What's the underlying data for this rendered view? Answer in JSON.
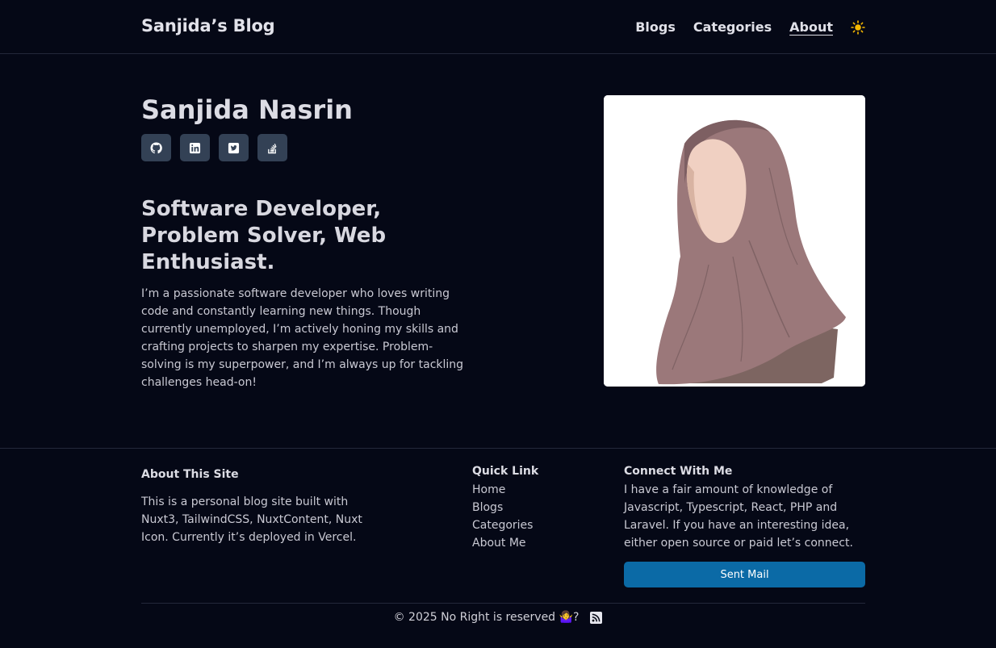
{
  "header": {
    "logo": "Sanjida’s Blog",
    "nav": [
      {
        "label": "Blogs"
      },
      {
        "label": "Categories"
      },
      {
        "label": "About"
      }
    ],
    "theme_icon": "sun-icon"
  },
  "hero": {
    "name": "Sanjida Nasrin",
    "socials": [
      {
        "icon": "github-icon"
      },
      {
        "icon": "linkedin-icon"
      },
      {
        "icon": "twitter-icon"
      },
      {
        "icon": "stackoverflow-icon"
      }
    ],
    "tagline": "Software Developer, Problem Solver, Web Enthusiast.",
    "bio": "I’m a passionate software developer who loves writing code and constantly learning new things. Though currently unemployed, I’m actively honing my skills and crafting projects to sharpen my expertise. Problem-solving is my superpower, and I’m always up for tackling challenges head-on!"
  },
  "footer": {
    "about_title": "About This Site",
    "about_text": "This is a personal blog site built with Nuxt3, TailwindCSS, NuxtContent, Nuxt Icon. Currently it’s deployed in Vercel.",
    "quick_link_title": "Quick Link",
    "quick_links": [
      "Home",
      "Blogs",
      "Categories",
      "About Me"
    ],
    "connect_title": "Connect With Me",
    "connect_text": "I have a fair amount of knowledge of Javascript, Typescript, React, PHP and Laravel. If you have an interesting idea, either open source or paid let’s connect.",
    "mail_button": "Sent Mail",
    "copyright": "© 2025 No Right is reserved 🤷‍♀️?",
    "rss_icon": "rss-icon"
  },
  "colors": {
    "background": "#050816",
    "social_bg": "#334155",
    "button": "#0b6aa6"
  }
}
